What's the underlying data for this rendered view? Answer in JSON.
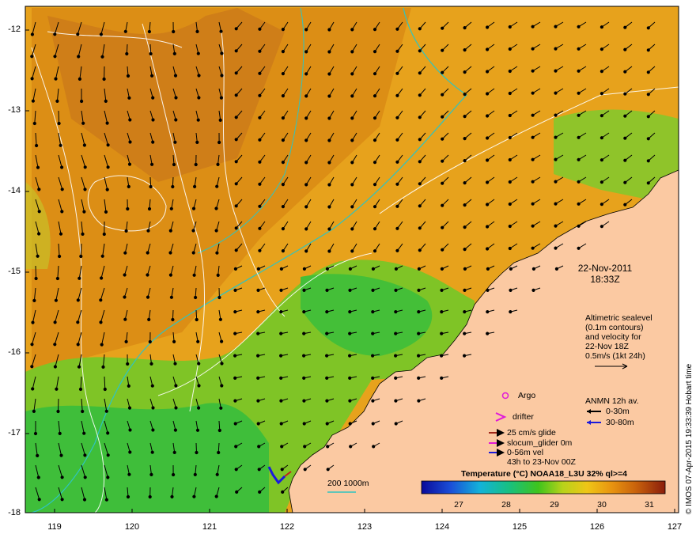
{
  "datetime": {
    "date": "22-Nov-2011",
    "time": "18:33Z"
  },
  "altimetry_note": [
    "Altimetric sealevel",
    "(0.1m contours)",
    "and velocity for",
    "22-Nov 18Z",
    "0.5m/s (1kt 24h)"
  ],
  "legend": {
    "argo": "Argo",
    "drifter": "drifter",
    "glide": "25 cm/s glide",
    "slocum": "slocum_glider 0m",
    "vel": "0-56m vel",
    "vel_time": "43h to 23-Nov 00Z",
    "anmn_title": "ANMN 12h av.",
    "anmn_shallow": "0-30m",
    "anmn_deep": "30-80m",
    "bathy": "200  1000m"
  },
  "colorbar": {
    "title": "Temperature (°C) NOAA18_L3U 32% ql>=4",
    "ticks": [
      "27",
      "28",
      "29",
      "30",
      "31"
    ],
    "range": [
      26.2,
      31.8
    ]
  },
  "axes": {
    "lat_ticks": [
      "-12",
      "-13",
      "-14",
      "-15",
      "-16",
      "-17",
      "-18"
    ],
    "lon_ticks": [
      "119",
      "120",
      "121",
      "122",
      "123",
      "124",
      "125",
      "126",
      "127"
    ],
    "lon_range": [
      118.6,
      127.0
    ],
    "lat_range": [
      -11.9,
      -18.0
    ]
  },
  "credit": "© IMOS 07-Apr-2015 19:33:39 Hobart time",
  "colors": {
    "land": "#fbc9a2",
    "isobath": "#2fc4c0",
    "contour": "#ffffff",
    "arrow": "#000000"
  }
}
